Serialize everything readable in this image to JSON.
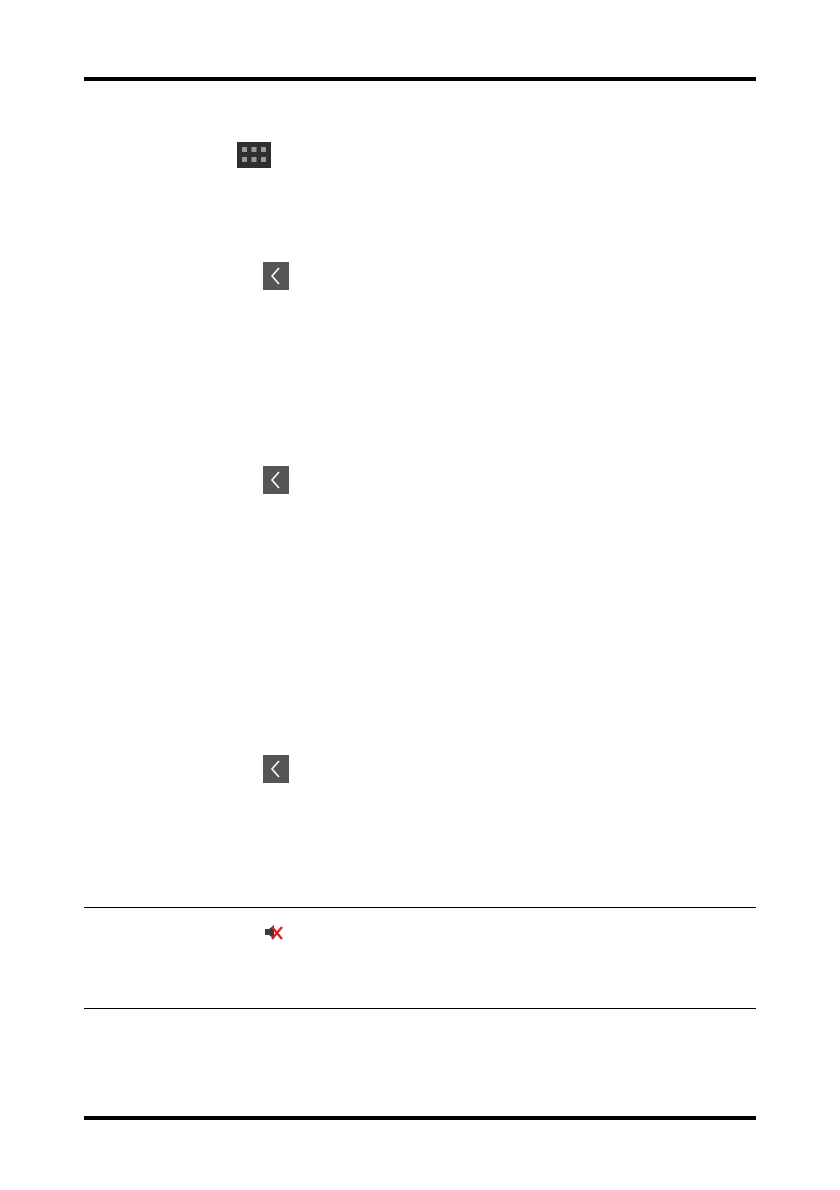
{
  "page": {
    "background": "#ffffff",
    "rule_color": "#000000"
  },
  "icons": [
    {
      "name": "grid-menu-icon",
      "fill": "#2f2f2f",
      "dot": "#9a9a9a"
    },
    {
      "name": "back-chevron-icon",
      "fill": "#555555",
      "stroke": "#ffffff"
    },
    {
      "name": "back-chevron-icon",
      "fill": "#555555",
      "stroke": "#ffffff"
    },
    {
      "name": "back-chevron-icon",
      "fill": "#555555",
      "stroke": "#ffffff"
    },
    {
      "name": "alarm-audio-off-icon",
      "fill": "#ffffff",
      "accent": "#e02020"
    }
  ]
}
